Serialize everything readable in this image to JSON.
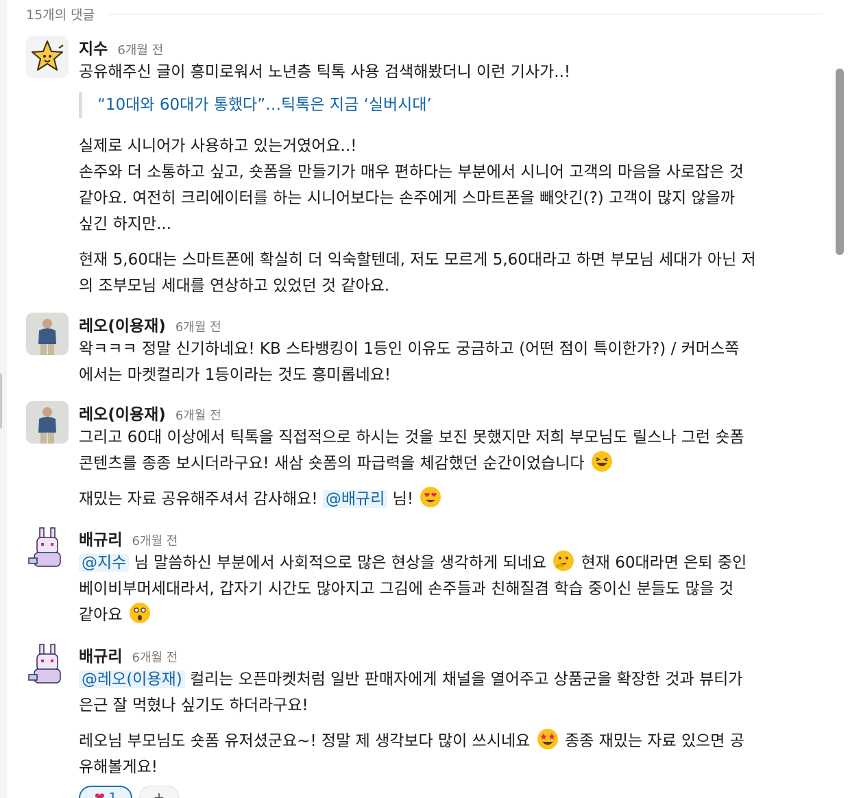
{
  "header": {
    "count_label": "15개의 댓글"
  },
  "comments": [
    {
      "author": "지수",
      "time": "6개월 전",
      "avatar_icon": "star-character-icon",
      "lines": [
        "공유해주신 글이 흥미로워서 노년층 틱톡 사용 검색해봤더니 이런 기사가..!"
      ],
      "quote": "“10대와 60대가 통했다”…틱톡은 지금 ‘실버시대’",
      "para2": [
        "실제로 시니어가 사용하고 있는거였어요..!",
        "손주와 더 소통하고 싶고, 숏폼을 만들기가 매우 편하다는 부분에서 시니어 고객의 마음을 사로잡은 것",
        "같아요. 여전히 크리에이터를 하는 시니어보다는 손주에게 스마트폰을 빼앗긴(?) 고객이 많지 않을까",
        "싶긴 하지만..."
      ],
      "para3": [
        "현재 5,60대는 스마트폰에 확실히 더 익숙할텐데, 저도 모르게 5,60대라고 하면 부모님 세대가 아닌 저",
        "의 조부모님 세대를 연상하고 있었던 것 같아요."
      ]
    },
    {
      "author": "레오(이용재)",
      "time": "6개월 전",
      "avatar_icon": "person-photo-icon",
      "lines": [
        "왁ㅋㅋㅋ 정말 신기하네요! KB 스타뱅킹이 1등인 이유도 궁금하고 (어떤 점이 특이한가?) / 커머스쪽",
        "에서는 마켓컬리가 1등이라는 것도 흥미롭네요!"
      ]
    },
    {
      "author": "레오(이용재)",
      "time": "6개월 전",
      "avatar_icon": "person-photo-icon",
      "line1": "그리고 60대 이상에서 틱톡을 직접적으로 하시는 것을 보진 못했지만 저희 부모님도 릴스나 그런 숏폼",
      "line2": "콘텐츠를 종종 보시더라구요! 새삼 숏폼의 파급력을 체감했던 순간이었습니다",
      "emoji_1": "laughing-emoji",
      "p2_before": "재밌는 자료 공유해주셔서 감사해요!",
      "p2_mention": "@배규리",
      "p2_after": "님!",
      "emoji_2": "heart-eyes-emoji"
    },
    {
      "author": "배규리",
      "time": "6개월 전",
      "avatar_icon": "bunny-pixel-icon",
      "mention": "@지수",
      "line1_after": "님 말씀하신 부분에서 사회적으로 많은 현상을 생각하게 되네요",
      "emoji_1": "thinking-emoji",
      "line1_tail": "현재 60대라면 은퇴 중인",
      "line2": "베이비부머세대라서, 갑자기 시간도 많아지고 그김에 손주들과 친해질겸 학습 중이신 분들도 많을 것",
      "line3": "같아요",
      "emoji_2": "astonished-emoji"
    },
    {
      "author": "배규리",
      "time": "6개월 전",
      "avatar_icon": "bunny-pixel-icon",
      "mention": "@레오(이용재)",
      "line1_after": "컬리는 오픈마켓처럼 일반 판매자에게 채널을 열어주고 상품군을 확장한 것과 뷰티가",
      "line2": "은근 잘 먹혔나 싶기도 하더라구요!",
      "p2_before": "레오님 부모님도 숏폼 유저셨군요~! 정말 제 생각보다 많이 쓰시네요",
      "emoji_1": "star-struck-emoji",
      "p2_after": "종종 재밌는 자료 있으면 공",
      "p2_line2": "유해볼게요!"
    }
  ],
  "reactions": {
    "heart": {
      "icon": "heart-icon",
      "count": "1"
    },
    "add": {
      "icon": "add-reaction-icon",
      "label": "+"
    }
  }
}
